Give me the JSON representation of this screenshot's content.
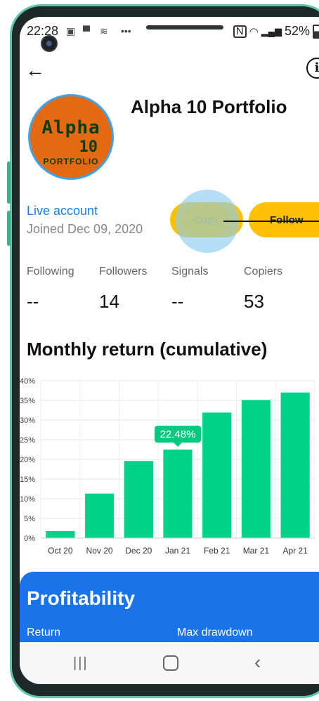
{
  "status_bar": {
    "time": "22:28",
    "battery": "52%",
    "notification_icons": [
      "image-icon",
      "message-icon",
      "app-icon",
      "more-icon"
    ]
  },
  "header": {
    "back_icon": "arrow-left-icon",
    "info_icon": "info-icon"
  },
  "profile": {
    "avatar_line1": "Alpha",
    "avatar_line2": "10",
    "avatar_line3": "PORTFOLIO",
    "title": "Alpha 10 Portfolio",
    "account_type": "Live account",
    "joined": "Joined Dec 09, 2020",
    "copy_label": "Copy",
    "follow_label": "Follow"
  },
  "stats": [
    {
      "label": "Following",
      "value": "--"
    },
    {
      "label": "Followers",
      "value": "14"
    },
    {
      "label": "Signals",
      "value": "--"
    },
    {
      "label": "Copiers",
      "value": "53"
    }
  ],
  "section_title": "Monthly return (cumulative)",
  "colors": {
    "bar": "#00d387",
    "accent_blue": "#1a73e8",
    "button_yellow": "#ffc107",
    "tooltip": "#00c87f"
  },
  "chart_data": {
    "type": "bar",
    "categories": [
      "Oct 20",
      "Nov 20",
      "Dec 20",
      "Jan 21",
      "Feb 21",
      "Mar 21",
      "Apr 21"
    ],
    "values": [
      1.8,
      11.3,
      19.6,
      22.48,
      31.9,
      35.1,
      37.0
    ],
    "ylim": [
      0,
      40
    ],
    "yticks": [
      "0%",
      "5%",
      "10%",
      "15%",
      "20%",
      "25%",
      "30%",
      "35%",
      "40%"
    ],
    "grid": true,
    "tooltip": {
      "category": "Jan 21",
      "label": "22.48%"
    }
  },
  "profitability": {
    "title": "Profitability",
    "col1": "Return",
    "col2": "Max drawdown"
  },
  "nav_bar": {
    "recents_icon": "recents-icon",
    "home_icon": "home-icon",
    "back_icon": "back-chevron-icon"
  }
}
